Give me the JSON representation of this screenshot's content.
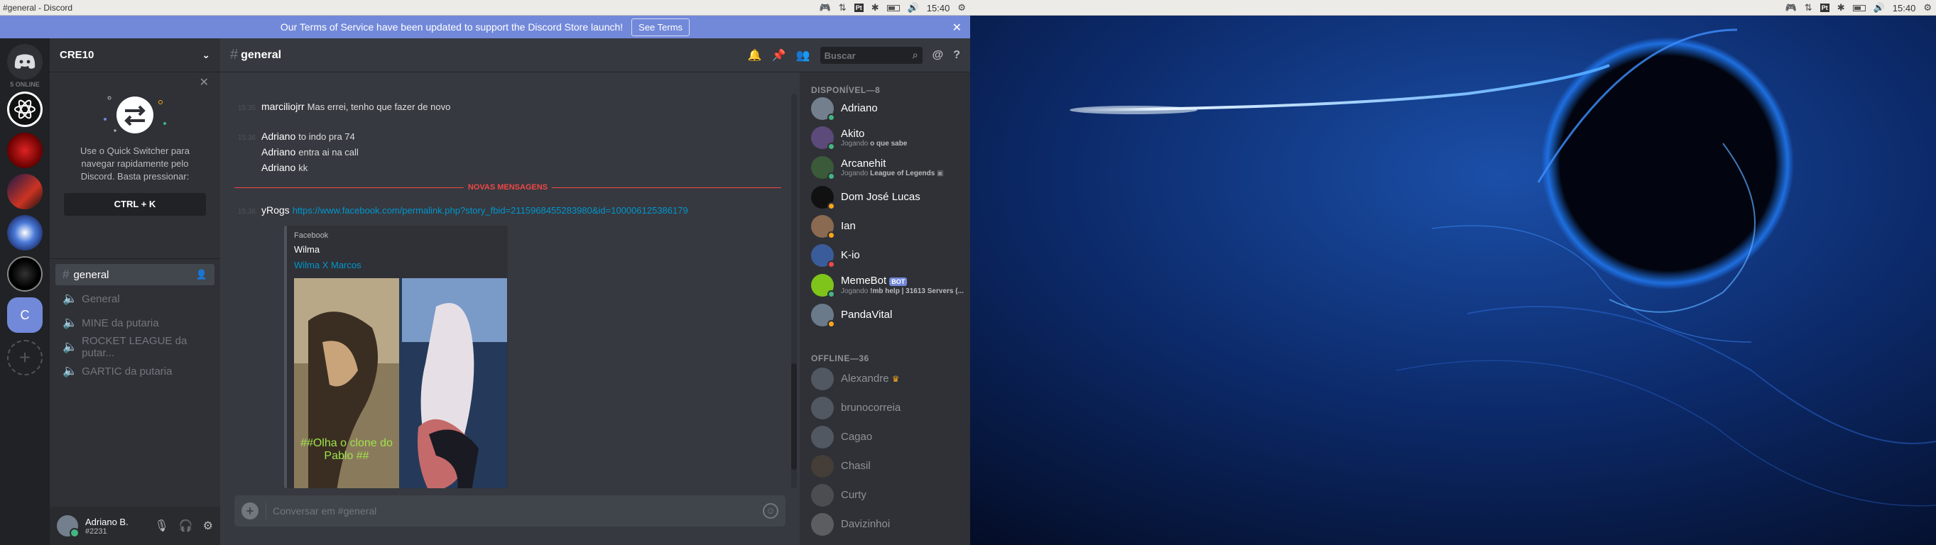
{
  "left_topbar": {
    "window_title": "#general - Discord",
    "clock": "15:40"
  },
  "right_topbar": {
    "clock": "15:40"
  },
  "tray": {
    "pt_label": "Pt"
  },
  "notice": {
    "text": "Our Terms of Service have been updated to support the Discord Store launch!",
    "button": "See Terms"
  },
  "guilds": {
    "online_text": "5 ONLINE",
    "selected_letter": "C"
  },
  "server": {
    "name": "CRE10"
  },
  "quick_switcher": {
    "text": "Use o Quick Switcher para navegar rapidamente pelo Discord. Basta pressionar:",
    "key": "CTRL + K"
  },
  "channels": [
    {
      "name": "general",
      "type": "text",
      "active": true
    },
    {
      "name": "General",
      "type": "voice"
    },
    {
      "name": "MINE da putaria",
      "type": "voice"
    },
    {
      "name": "ROCKET LEAGUE da putar...",
      "type": "voice"
    },
    {
      "name": "GARTIC da putaria",
      "type": "voice"
    }
  ],
  "user": {
    "name": "Adriano B.",
    "tag": "#2231"
  },
  "chat": {
    "channel": "general",
    "search_placeholder": "Buscar",
    "compose_placeholder": "Conversar em #general"
  },
  "messages": [
    {
      "time": "15:35",
      "author": "marciliojrr",
      "text": "Mas errei, tenho que fazer de novo"
    },
    {
      "time": "15:36",
      "author": "Adriano",
      "text": "to indo pra 74"
    },
    {
      "time": "",
      "author": "Adriano",
      "text": "entra ai na call"
    },
    {
      "time": "",
      "author": "Adriano",
      "text": "kk"
    },
    {
      "time": "15:38",
      "author": "yRogs",
      "link": "https://www.facebook.com/permalink.php?story_fbid=2115968455283980&id=100006125386179"
    }
  ],
  "divider": "NOVAS MENSAGENS",
  "embed": {
    "provider": "Facebook",
    "title": "Wilma",
    "subtitle": "Wilma X Marcos",
    "caption": "##Olha o clone do Pablo ##"
  },
  "members": {
    "online_header": "DISPONÍVEL—8",
    "offline_header": "OFFLINE—36",
    "online": [
      {
        "name": "Adriano",
        "status": "online",
        "color": "#747f8d"
      },
      {
        "name": "Akito",
        "playing_prefix": "Jogando",
        "game": "o que sabe",
        "status": "online",
        "color": "#5b4a7a"
      },
      {
        "name": "Arcanehit",
        "playing_prefix": "Jogando",
        "game": "League of Legends",
        "status": "online",
        "color": "#3a5a3a"
      },
      {
        "name": "Dom José Lucas",
        "status": "idle",
        "color": "#111111"
      },
      {
        "name": "Ian",
        "status": "idle",
        "color": "#8a6a50"
      },
      {
        "name": "K-io",
        "status": "dnd",
        "color": "#3b5c9a"
      },
      {
        "name": "MemeBot",
        "bot": "BOT",
        "playing_prefix": "Jogando",
        "game": "!mb help | 31613 Servers (...",
        "status": "online",
        "color": "#7ec41b"
      },
      {
        "name": "PandaVital",
        "status": "idle",
        "color": "#6a7a8a"
      }
    ],
    "offline": [
      {
        "name": "Alexandre",
        "crown": true,
        "color": "#747f8d"
      },
      {
        "name": "brunocorreia",
        "color": "#747f8d"
      },
      {
        "name": "Cagao",
        "color": "#747f8d"
      },
      {
        "name": "Chasil",
        "color": "#5a4a3a"
      },
      {
        "name": "Curty",
        "color": "#6a6a6a"
      },
      {
        "name": "Davizinhoi",
        "color": "#8a8a8a"
      }
    ]
  },
  "colors": {
    "accent": "#7289da",
    "online": "#43b581",
    "idle": "#faa61a",
    "dnd": "#f04747",
    "new_messages": "#f04747",
    "link": "#0096cf"
  }
}
